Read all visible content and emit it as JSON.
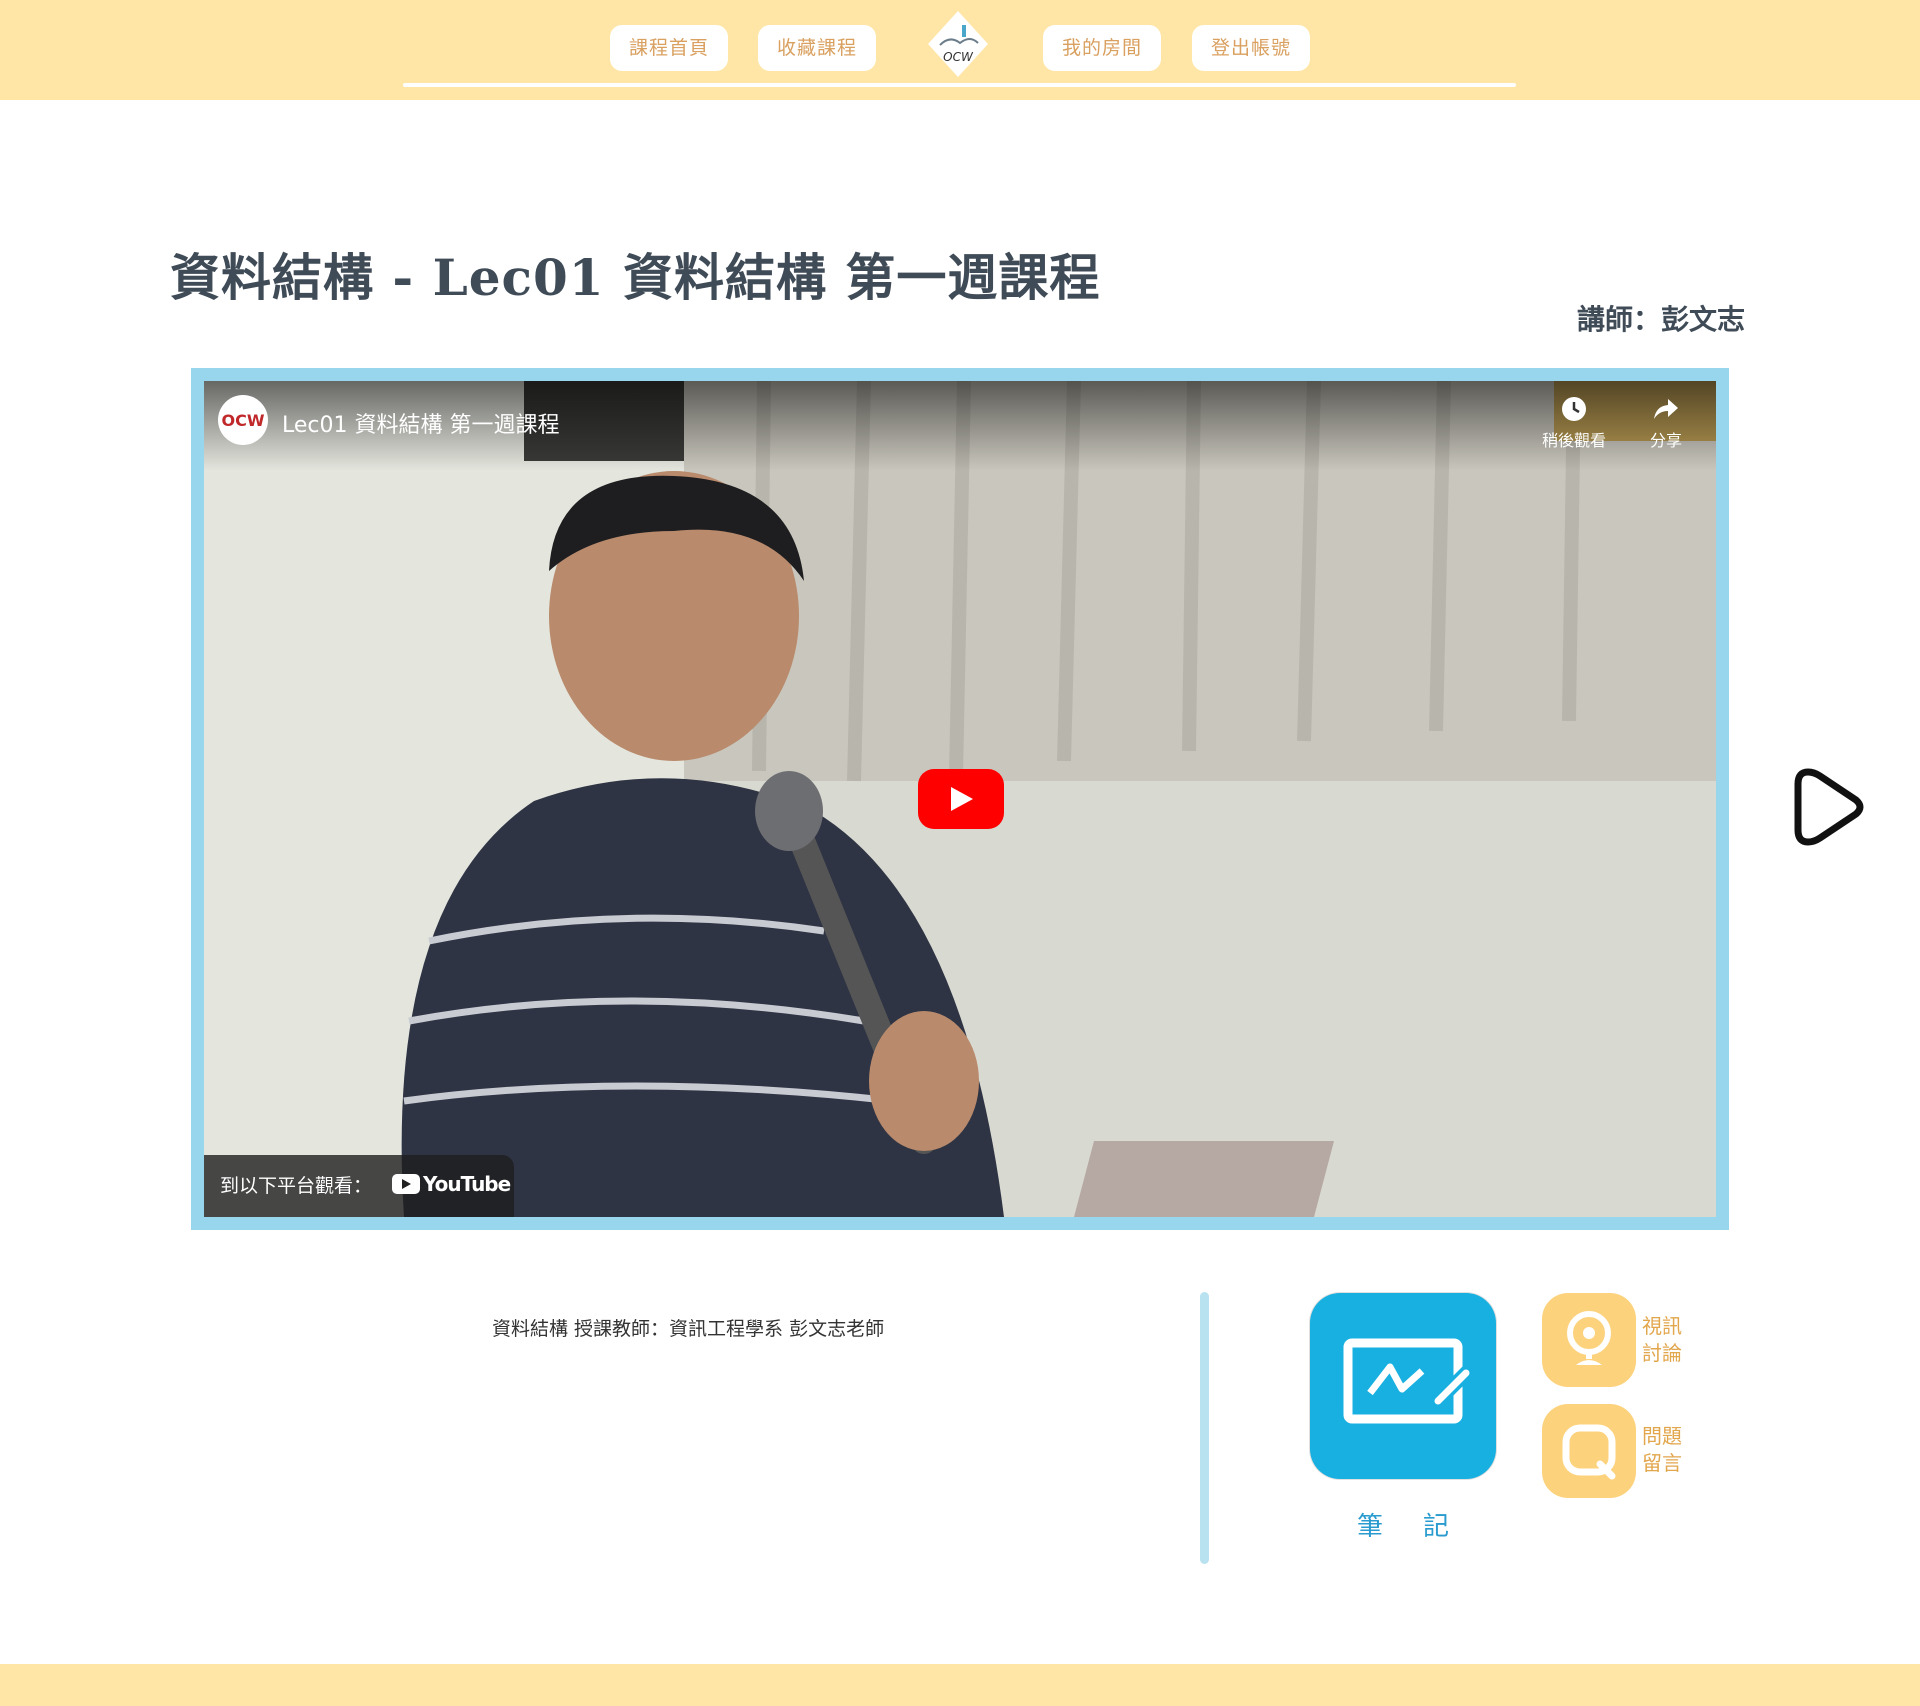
{
  "nav": {
    "course_home": "課程首頁",
    "saved_courses": "收藏課程",
    "logo_text": "OCW",
    "my_room": "我的房間",
    "logout": "登出帳號"
  },
  "page": {
    "title": "資料結構 - Lec01 資料結構 第一週課程",
    "instructor": "講師：彭文志"
  },
  "video": {
    "channel_logo_text": "OCW",
    "title": "Lec01 資料結構 第一週課程",
    "watch_later": "稍後觀看",
    "share": "分享",
    "watch_on": "到以下平台觀看：",
    "youtube": "YouTube"
  },
  "description": "資料結構 授課教師：資訊工程學系 彭文志老師",
  "tools": {
    "notes": "筆記",
    "video_discussion": [
      "視訊",
      "討論"
    ],
    "questions": [
      "問題",
      "留言"
    ]
  },
  "colors": {
    "header_bg": "#ffe6a6",
    "nav_text": "#d9a060",
    "video_border": "#98d6ee",
    "note_button": "#18b0e0",
    "side_button": "#fcd27d",
    "youtube_red": "#ff0000"
  },
  "icons": {
    "next": "chevron-play-outline-icon",
    "notes": "whiteboard-pen-icon",
    "video_discussion": "webcam-icon",
    "questions": "q-bubble-icon",
    "watch_later": "clock-icon",
    "share": "share-arrow-icon"
  }
}
